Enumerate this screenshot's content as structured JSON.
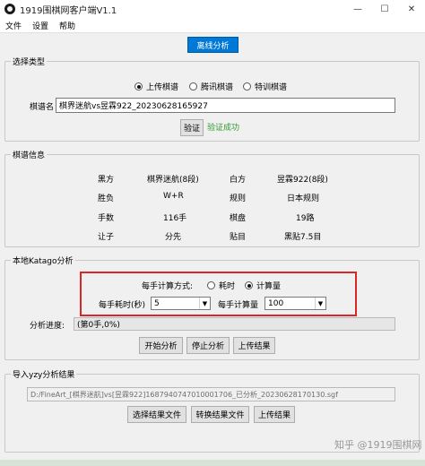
{
  "window": {
    "title": "1919围棋网客户端V1.1",
    "minimize": "—",
    "maximize": "☐",
    "close": "✕"
  },
  "menu": [
    "文件",
    "设置",
    "帮助"
  ],
  "top_tab": "离线分析",
  "select_type": {
    "title": "选择类型",
    "options": [
      {
        "label": "上传棋谱",
        "selected": true
      },
      {
        "label": "腾讯棋谱",
        "selected": false
      },
      {
        "label": "特训棋谱",
        "selected": false
      }
    ],
    "name_label": "棋谱名",
    "name_value": "棋界迷航vs昱霖922_20230628165927",
    "verify_button": "验证",
    "verify_status": "验证成功"
  },
  "game_info": {
    "title": "棋谱信息",
    "rows": [
      [
        "黑方",
        "棋界迷航(8段)",
        "白方",
        "昱霖922(8段)"
      ],
      [
        "胜负",
        "W+R",
        "规则",
        "日本规则"
      ],
      [
        "手数",
        "116手",
        "棋盘",
        "19路"
      ],
      [
        "让子",
        "分先",
        "贴目",
        "黑贴7.5目"
      ]
    ]
  },
  "katago": {
    "title": "本地Katago分析",
    "mode_label": "每手计算方式:",
    "mode_options": [
      {
        "label": "耗时",
        "selected": false
      },
      {
        "label": "计算量",
        "selected": true
      }
    ],
    "time_label": "每手耗时(秒)",
    "time_value": "5",
    "calc_label": "每手计算量",
    "calc_value": "100",
    "progress_label": "分析进度:",
    "progress_value": "(第0手,0%)",
    "buttons": [
      "开始分析",
      "停止分析",
      "上传结果"
    ]
  },
  "import": {
    "title": "导入yzy分析结果",
    "path": "D:/FineArt_[棋界迷航]vs[昱霖922]1687940747010001706_已分析_20230628170130.sgf",
    "buttons": [
      "选择结果文件",
      "转换结果文件",
      "上传结果"
    ]
  },
  "watermark": "知乎 @1919围棋网"
}
